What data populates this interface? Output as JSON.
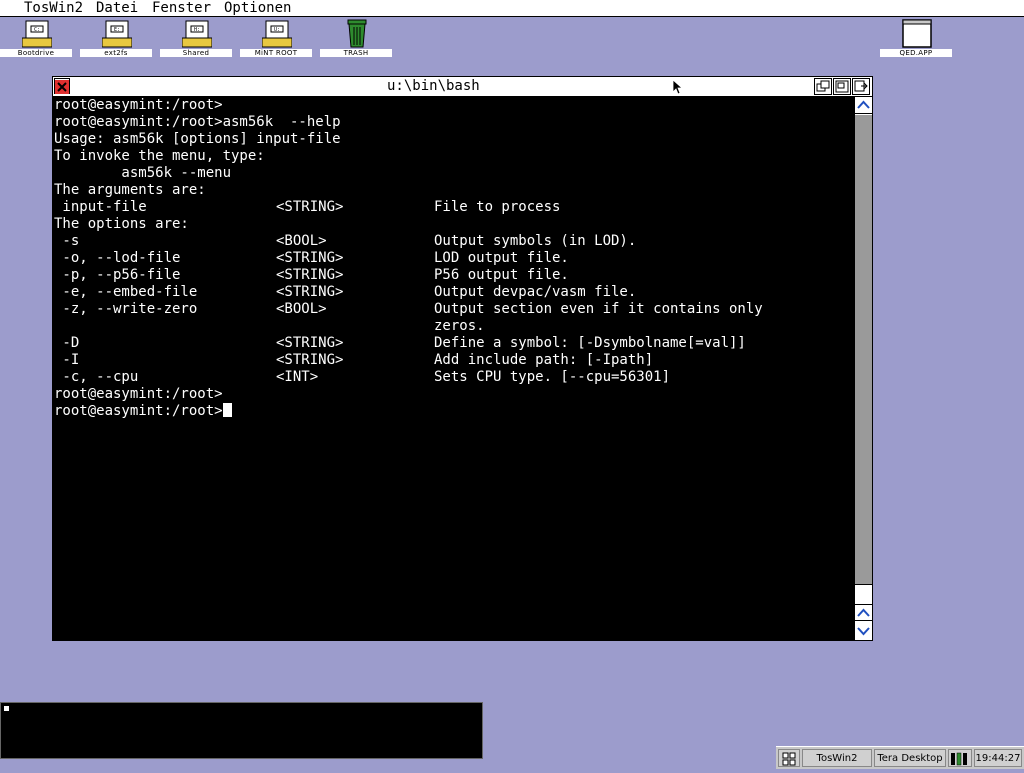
{
  "menubar": {
    "items": [
      "TosWin2",
      "Datei",
      "Fenster",
      "Optionen"
    ]
  },
  "desktop_icons": [
    {
      "label": "Bootdrive",
      "icon": "drive-icon"
    },
    {
      "label": "ext2fs",
      "icon": "drive-icon"
    },
    {
      "label": "Shared",
      "icon": "drive-icon"
    },
    {
      "label": "MiNT ROOT",
      "icon": "drive-icon"
    },
    {
      "label": "TRASH",
      "icon": "trash-icon"
    },
    {
      "label": "QED.APP",
      "icon": "application-icon"
    }
  ],
  "window": {
    "title": "u:\\bin\\bash",
    "lines": [
      {
        "c1": "root@easymint:/root>"
      },
      {
        "c1": "root@easymint:/root>asm56k  --help"
      },
      {
        "c1": "Usage: asm56k [options] input-file"
      },
      {
        "c1": "To invoke the menu, type:"
      },
      {
        "c1": "        asm56k --menu"
      },
      {
        "c1": "The arguments are:"
      },
      {
        "c1": " input-file",
        "c2": "<STRING>",
        "c3": "File to process"
      },
      {
        "c1": "The options are:"
      },
      {
        "c1": " -s",
        "c2": "<BOOL>",
        "c3": "Output symbols (in LOD)."
      },
      {
        "c1": " -o, --lod-file",
        "c2": "<STRING>",
        "c3": "LOD output file."
      },
      {
        "c1": " -p, --p56-file",
        "c2": "<STRING>",
        "c3": "P56 output file."
      },
      {
        "c1": " -e, --embed-file",
        "c2": "<STRING>",
        "c3": "Output devpac/vasm file."
      },
      {
        "c1": " -z, --write-zero",
        "c2": "<BOOL>",
        "c3": "Output section even if it contains only"
      },
      {
        "c3": "zeros."
      },
      {
        "c1": " -D",
        "c2": "<STRING>",
        "c3": "Define a symbol: [-Dsymbolname[=val]]"
      },
      {
        "c1": " -I",
        "c2": "<STRING>",
        "c3": "Add include path: [-Ipath]"
      },
      {
        "c1": " -c, --cpu",
        "c2": "<INT>",
        "c3": "Sets CPU type. [--cpu=56301]"
      },
      {
        "c1": "root@easymint:/root>"
      },
      {
        "c1": "root@easymint:/root>",
        "cursor": true
      }
    ]
  },
  "taskbar": {
    "items": [
      "TosWin2",
      "Tera Desktop"
    ],
    "clock": "19:44:27"
  },
  "colors": {
    "desktop": "#9c9ccc",
    "terminal_bg": "#000000",
    "terminal_fg": "#ffffff"
  }
}
